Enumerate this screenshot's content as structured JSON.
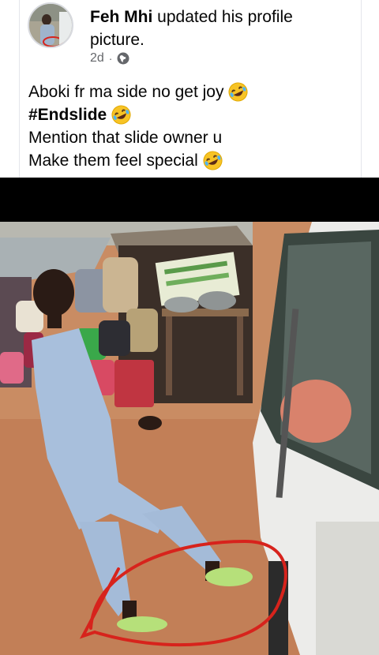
{
  "post": {
    "author": "Feh  Mhi",
    "action": "updated his profile",
    "action_cont": "picture.",
    "time": "2d",
    "privacy_icon": "globe-icon",
    "lines": [
      "Aboki fr ma side no get joy",
      "#Endslide",
      "Mention that slide owner u",
      "Make them feel special"
    ],
    "emoji_icon": "rolling-on-floor-laughing-emoji"
  },
  "colors": {
    "meta": "#65676b",
    "text": "#050505",
    "annotation_circle": "#d7231c"
  }
}
